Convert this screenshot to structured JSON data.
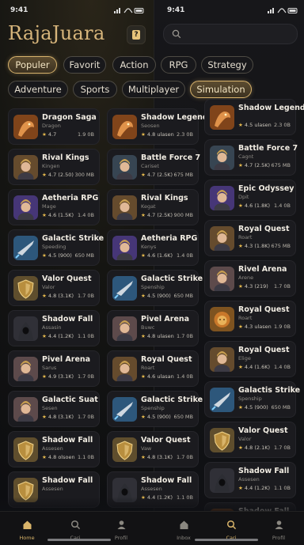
{
  "status": {
    "time_left": "9:41",
    "time_right": "9:41"
  },
  "app": {
    "title": "RajaJuara"
  },
  "search": {
    "placeholder": ""
  },
  "filters": {
    "row1": [
      "Populer",
      "Favorit",
      "Action",
      "RPG",
      "Strategy"
    ],
    "row2": [
      "Adventure",
      "Sports",
      "Multiplayer",
      "Simulation"
    ]
  },
  "columns": [
    [
      {
        "title": "Dragon Saga",
        "sub": "Dragon",
        "rating": "4.7",
        "count": "",
        "size": "1.9 0B",
        "icon": "dragon-icon"
      },
      {
        "title": "Rival Kings",
        "sub": "Kingen",
        "rating": "4.7",
        "count": "(2.50)",
        "size": "300 MB",
        "icon": "king-icon"
      },
      {
        "title": "Aetheria RPG",
        "sub": "Mage",
        "rating": "4.6",
        "count": "(1.5K)",
        "size": "1.4 0B",
        "icon": "mage-icon"
      },
      {
        "title": "Galactic Strike",
        "sub": "Speeding",
        "rating": "4.5",
        "count": "(900)",
        "size": "650 MB",
        "icon": "spaceship-icon"
      },
      {
        "title": "Valor Quest",
        "sub": "Valor",
        "rating": "4.8",
        "count": "(3.1K)",
        "size": "1.7 0B",
        "icon": "shield-icon"
      },
      {
        "title": "Shadow Fall",
        "sub": "Assasin",
        "rating": "4.4",
        "count": "(1.2K)",
        "size": "1.1 0B",
        "icon": "assassin-icon"
      },
      {
        "title": "Pivel Arena",
        "sub": "Sarus",
        "rating": "4.9",
        "count": "(3.1K)",
        "size": "1.7 0B",
        "icon": "warrior-icon"
      },
      {
        "title": "Galactic Suat",
        "sub": "Sesen",
        "rating": "4.8",
        "count": "(3.1K)",
        "size": "1.7 0B",
        "icon": "warrior-icon"
      },
      {
        "title": "Shadow Fall",
        "sub": "Assesen",
        "rating": "4.8",
        "count": "olsoen",
        "size": "1.1 0B",
        "icon": "shield-icon"
      },
      {
        "title": "Shadow Fall",
        "sub": "Assesen",
        "rating": "",
        "count": "",
        "size": "",
        "icon": "shield-icon"
      }
    ],
    [
      {
        "title": "Shadow Legends",
        "sub": "Seosen",
        "rating": "4.8",
        "count": "ulasen",
        "size": "2.3 0B",
        "icon": "dragon-icon"
      },
      {
        "title": "Battle Force 7",
        "sub": "Cariset",
        "rating": "4.7",
        "count": "(2.5K)",
        "size": "675 MB",
        "icon": "soldier-icon"
      },
      {
        "title": "Rival Kings",
        "sub": "Kegat",
        "rating": "4.7",
        "count": "(2.5K)",
        "size": "900 MB",
        "icon": "king-icon"
      },
      {
        "title": "Aetheria RPG",
        "sub": "Kenys",
        "rating": "4.6",
        "count": "(1.6K)",
        "size": "1.4 0B",
        "icon": "mage-icon"
      },
      {
        "title": "Galactic Strike",
        "sub": "Spenship",
        "rating": "4.5",
        "count": "(900)",
        "size": "650 MB",
        "icon": "spaceship-icon"
      },
      {
        "title": "Pivel Arena",
        "sub": "Buwc",
        "rating": "4.8",
        "count": "ulasen",
        "size": "1.7 0B",
        "icon": "warrior-icon"
      },
      {
        "title": "Royal Quest",
        "sub": "Roart",
        "rating": "4.6",
        "count": "ulasan",
        "size": "1.4 0B",
        "icon": "king-icon"
      },
      {
        "title": "Galactic Strike",
        "sub": "Spenship",
        "rating": "4.5",
        "count": "(900)",
        "size": "650 MB",
        "icon": "spaceship-icon"
      },
      {
        "title": "Valor Quest",
        "sub": "Vaw",
        "rating": "4.8",
        "count": "(3.1K)",
        "size": "1.7 0B",
        "icon": "shield-icon"
      },
      {
        "title": "Shadow Fall",
        "sub": "Assesen",
        "rating": "4.4",
        "count": "(1.2K)",
        "size": "1.1 0B",
        "icon": "assassin-icon"
      },
      {
        "title": "Shadow Fall",
        "sub": "",
        "rating": "",
        "count": "",
        "size": "",
        "icon": "dragon-icon"
      }
    ],
    [
      {
        "title": "Shadow Legends",
        "sub": "",
        "rating": "4.5",
        "count": "ulasen",
        "size": "2.3 0B",
        "icon": "dragon-icon"
      },
      {
        "title": "Battle Force 7",
        "sub": "Cagnt",
        "rating": "4.7",
        "count": "(2.5K)",
        "size": "675 MB",
        "icon": "soldier-icon"
      },
      {
        "title": "Epic Odyssey",
        "sub": "Dpit",
        "rating": "4.6",
        "count": "(1.8K)",
        "size": "1.4 0B",
        "icon": "mage-icon"
      },
      {
        "title": "Royal Quest",
        "sub": "Roart",
        "rating": "4.3",
        "count": "(1.8K)",
        "size": "675 MB",
        "icon": "king-icon"
      },
      {
        "title": "Rivel Arena",
        "sub": "Arene",
        "rating": "4.3",
        "count": "(219)",
        "size": "1.7 0B",
        "icon": "warrior-icon"
      },
      {
        "title": "Royal Quest",
        "sub": "Roart",
        "rating": "4.3",
        "count": "ulasen",
        "size": "1.9 0B",
        "icon": "lion-icon"
      },
      {
        "title": "Royal Quest",
        "sub": "Elige",
        "rating": "4.4",
        "count": "(1.6K)",
        "size": "1.4 0B",
        "icon": "king-icon"
      },
      {
        "title": "Galactis Strike",
        "sub": "Spenship",
        "rating": "4.5",
        "count": "(900)",
        "size": "650 MB",
        "icon": "spaceship-icon"
      },
      {
        "title": "Valor Quest",
        "sub": "Valor",
        "rating": "4.8",
        "count": "(2.1K)",
        "size": "1.7 0B",
        "icon": "shield-icon"
      },
      {
        "title": "Shadow Fall",
        "sub": "Assesen",
        "rating": "4.4",
        "count": "(1.2K)",
        "size": "1.1 0B",
        "icon": "assassin-icon"
      },
      {
        "title": "Shadow Fall",
        "sub": "",
        "rating": "",
        "count": "",
        "size": "",
        "icon": "dragon-icon"
      }
    ]
  ],
  "nav": [
    {
      "label": "Home",
      "icon": "home-icon",
      "active": true
    },
    {
      "label": "Cari",
      "icon": "search-icon",
      "active": false
    },
    {
      "label": "Profil",
      "icon": "profile-icon",
      "active": false
    },
    {
      "label": "Inbox",
      "icon": "home-icon",
      "active": false
    },
    {
      "label": "Cari",
      "icon": "search-icon",
      "active": true
    },
    {
      "label": "Profil",
      "icon": "profile-icon",
      "active": false
    }
  ],
  "colors": {
    "accent": "#d8b36d",
    "background": "#0f1014",
    "card": "#1b1b1f"
  }
}
